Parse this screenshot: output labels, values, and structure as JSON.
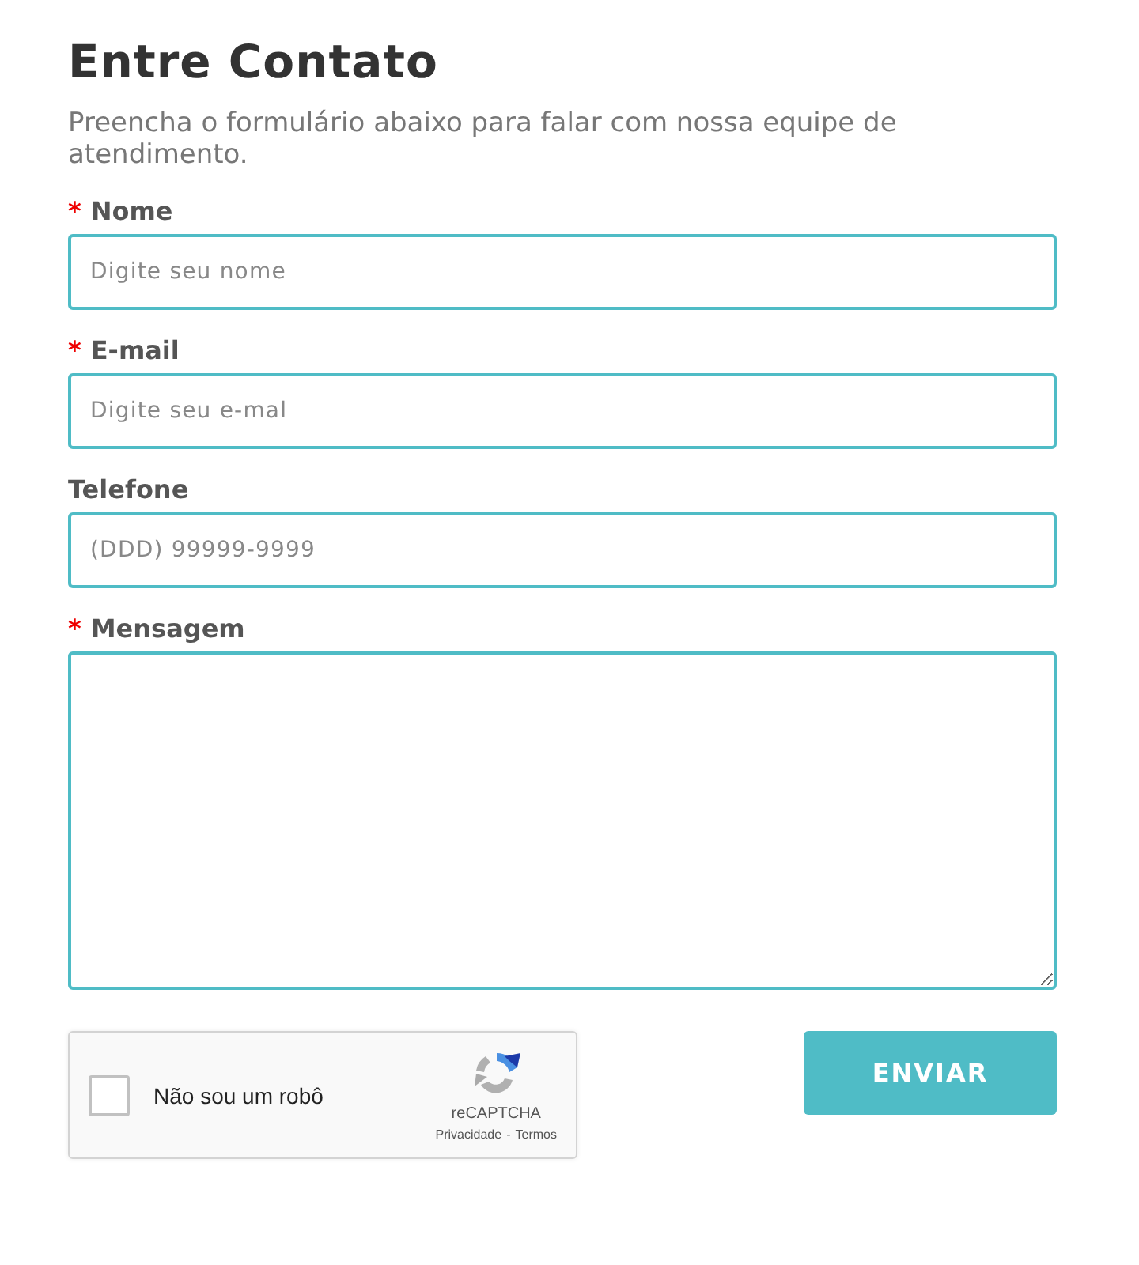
{
  "title": "Entre Contato",
  "subtitle": "Preencha o formulário abaixo para falar com nossa equipe de atendimento.",
  "required_mark": "*",
  "fields": [
    {
      "kind": "input",
      "label": "Nome",
      "required": true,
      "placeholder": "Digite seu nome"
    },
    {
      "kind": "input",
      "label": "E-mail",
      "required": true,
      "placeholder": "Digite seu e-mal"
    },
    {
      "kind": "input",
      "label": "Telefone",
      "required": false,
      "placeholder": "(DDD) 99999-9999"
    },
    {
      "kind": "textarea",
      "label": "Mensagem",
      "required": true
    }
  ],
  "captcha": {
    "label": "Não sou um robô",
    "checked": false,
    "brand": "reCAPTCHA",
    "privacy": "Privacidade",
    "separator": "-",
    "terms": "Termos"
  },
  "submit": "ENVIAR"
}
